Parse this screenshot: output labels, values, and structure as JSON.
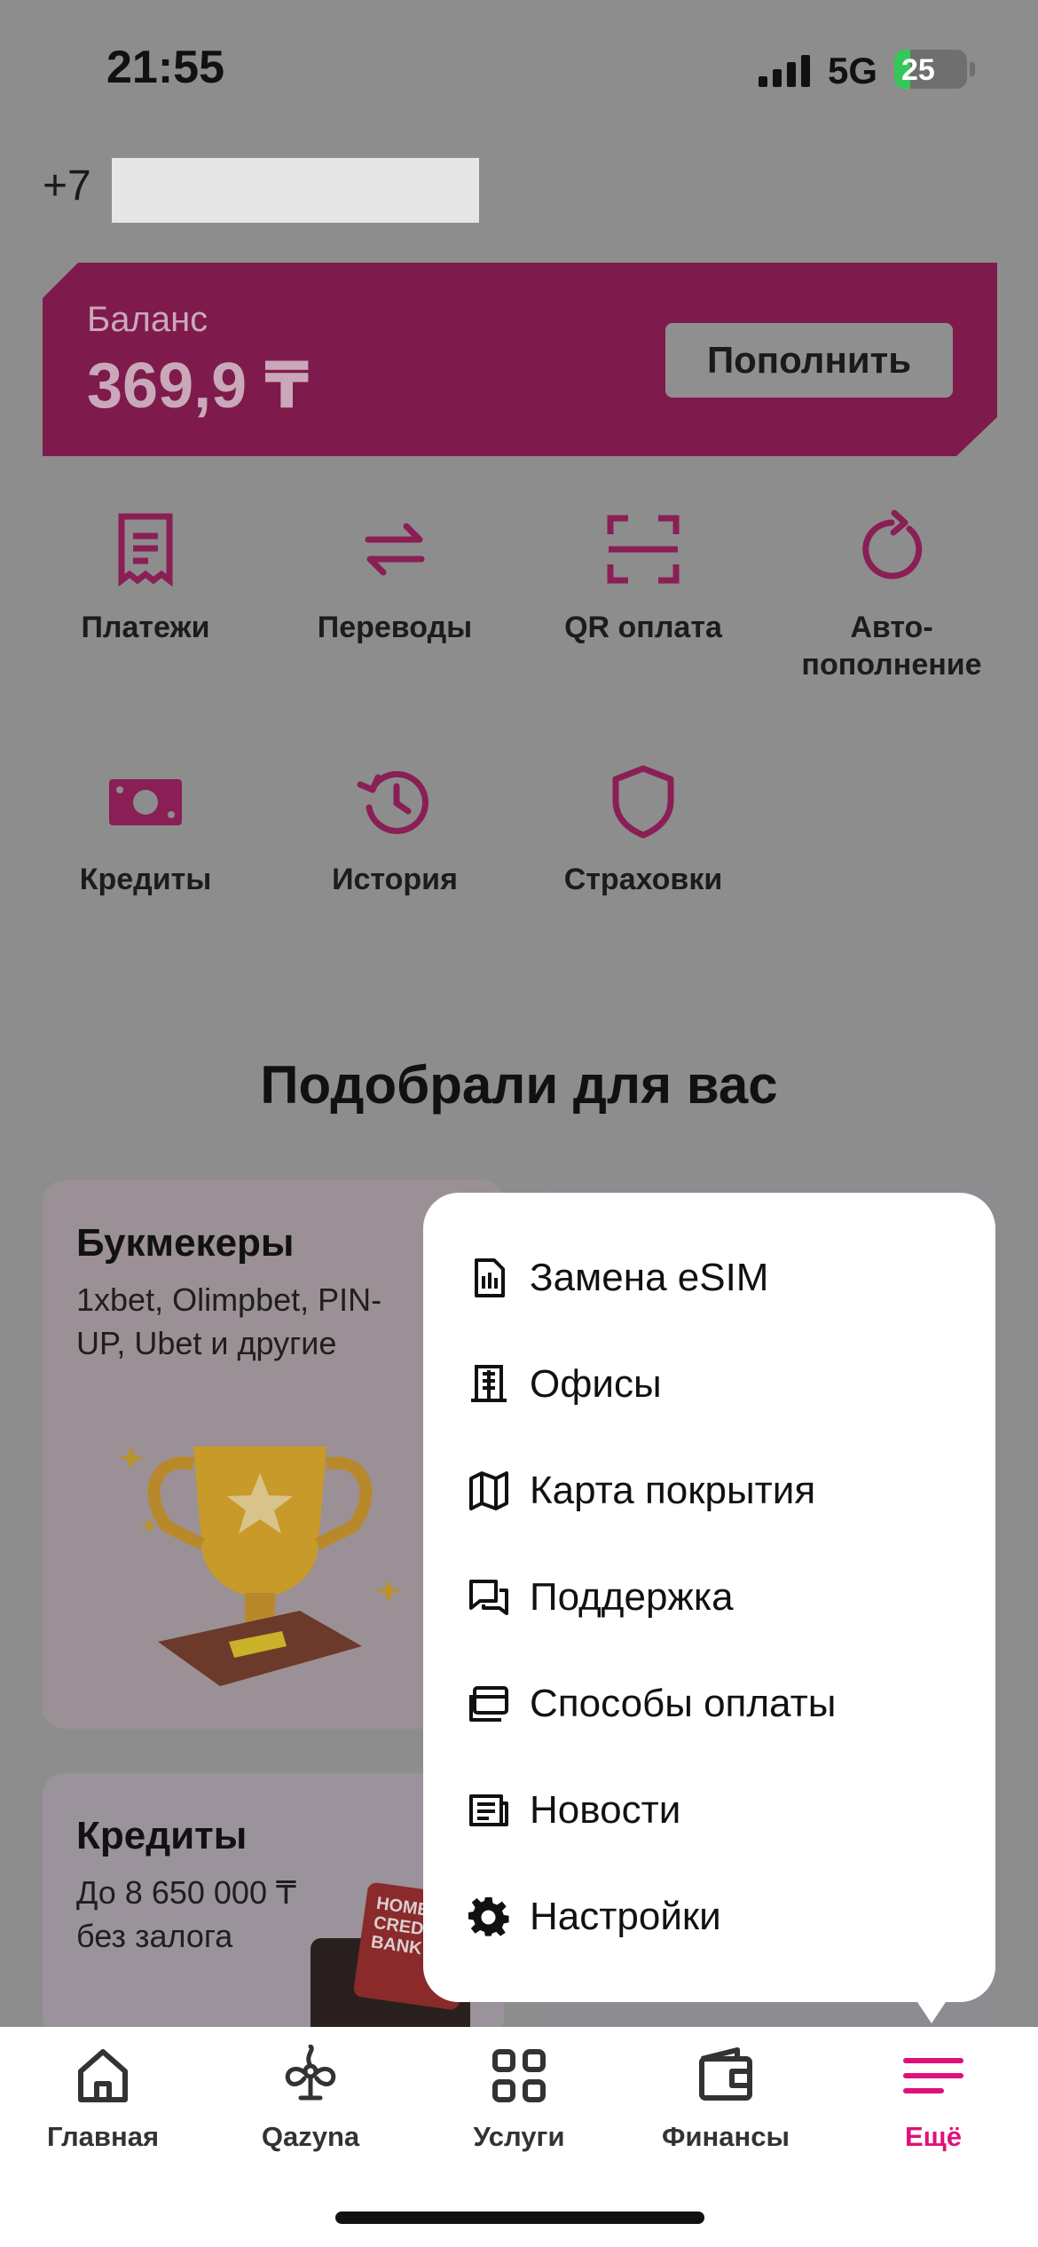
{
  "status": {
    "time": "21:55",
    "network": "5G",
    "battery": "25",
    "battery_level": 0.25
  },
  "account": {
    "phone_prefix": "+7"
  },
  "balance": {
    "label": "Баланс",
    "value": "369,9 ₸",
    "topup_label": "Пополнить"
  },
  "quick_actions": [
    {
      "label": "Платежи",
      "icon": "receipt-icon"
    },
    {
      "label": "Переводы",
      "icon": "transfer-arrows-icon"
    },
    {
      "label": "QR оплата",
      "icon": "qr-scan-icon"
    },
    {
      "label": "Авто-\nпополнение",
      "icon": "refresh-icon"
    },
    {
      "label": "Кредиты",
      "icon": "cash-icon"
    },
    {
      "label": "История",
      "icon": "history-icon"
    },
    {
      "label": "Страховки",
      "icon": "shield-icon"
    }
  ],
  "recommendations": {
    "title": "Подобрали для вас",
    "cards": [
      {
        "title": "Букмекеры",
        "subtitle": "1xbet, Olimpbet, PIN-\nUP, Ubet и другие"
      },
      {
        "title": "Кредиты",
        "subtitle": "До 8 650 000 ₸\nбез залога",
        "logo_text": "HOME CREDIT BANK"
      }
    ]
  },
  "more_menu": [
    {
      "label": "Замена eSIM",
      "icon": "sim-card-icon"
    },
    {
      "label": "Офисы",
      "icon": "building-icon"
    },
    {
      "label": "Карта покрытия",
      "icon": "map-icon"
    },
    {
      "label": "Поддержка",
      "icon": "chat-icon"
    },
    {
      "label": "Способы оплаты",
      "icon": "cards-icon"
    },
    {
      "label": "Новости",
      "icon": "news-icon"
    },
    {
      "label": "Настройки",
      "icon": "gear-icon"
    }
  ],
  "tabbar": [
    {
      "label": "Главная",
      "icon": "home-icon"
    },
    {
      "label": "Qazyna",
      "icon": "qazyna-icon"
    },
    {
      "label": "Услуги",
      "icon": "grid-icon"
    },
    {
      "label": "Финансы",
      "icon": "wallet-icon"
    },
    {
      "label": "Ещё",
      "icon": "menu-lines-icon",
      "active": true
    }
  ],
  "colors": {
    "accent": "#e0107a",
    "accent_dim": "#7f1a4d",
    "overlay": "#8d8d8d",
    "icon_dim": "#8a1f55"
  }
}
